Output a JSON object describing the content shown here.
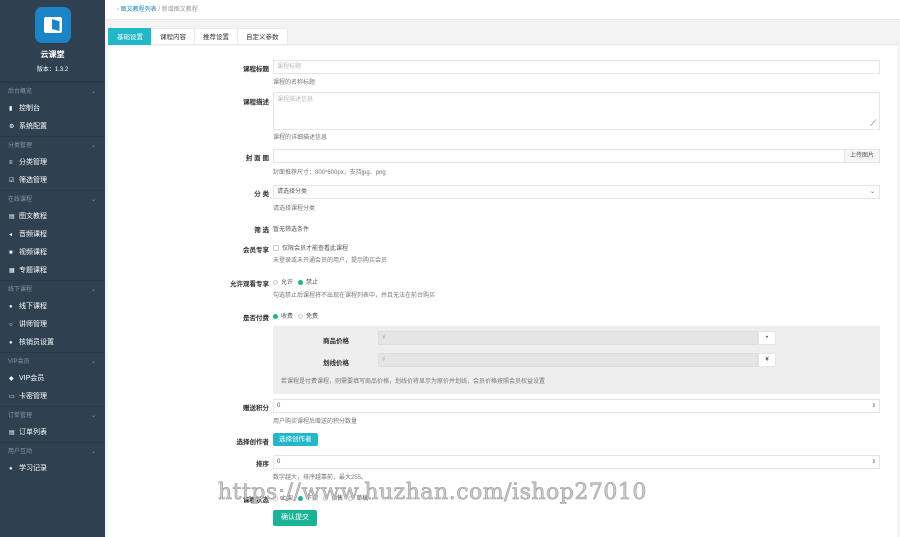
{
  "sidebar": {
    "brand_name": "云课堂",
    "version": "版本：1.3.2",
    "groups": [
      {
        "label": "后台概览",
        "items": [
          {
            "label": "控制台",
            "icon": "chart-icon"
          },
          {
            "label": "系统配置",
            "icon": "gear-icon"
          }
        ]
      },
      {
        "label": "分类管理",
        "items": [
          {
            "label": "分类管理",
            "icon": "list-icon"
          },
          {
            "label": "筛选管理",
            "icon": "check-icon"
          }
        ]
      },
      {
        "label": "在线课程",
        "items": [
          {
            "label": "图文教程",
            "icon": "doc-icon"
          },
          {
            "label": "音频课程",
            "icon": "audio-icon"
          },
          {
            "label": "视频课程",
            "icon": "video-icon"
          },
          {
            "label": "专题课程",
            "icon": "book-icon"
          }
        ]
      },
      {
        "label": "线下课程",
        "items": [
          {
            "label": "线下课程",
            "icon": "person-icon"
          },
          {
            "label": "讲师管理",
            "icon": "circle-icon"
          },
          {
            "label": "核销员设置",
            "icon": "person-add-icon"
          }
        ]
      },
      {
        "label": "VIP会员",
        "items": [
          {
            "label": "VIP会员",
            "icon": "diamond-icon"
          },
          {
            "label": "卡密管理",
            "icon": "card-icon"
          }
        ]
      },
      {
        "label": "订单管理",
        "items": [
          {
            "label": "订单列表",
            "icon": "orders-icon"
          }
        ]
      },
      {
        "label": "用户互动",
        "items": [
          {
            "label": "学习记录",
            "icon": "record-icon"
          }
        ]
      }
    ]
  },
  "breadcrumb": {
    "parent": "图文教程列表",
    "current": "新增图文教程"
  },
  "tabs": [
    "基础设置",
    "课程内容",
    "推荐设置",
    "自定义参数"
  ],
  "form": {
    "title": {
      "label": "课程标题",
      "placeholder": "课程标题",
      "help": "课程的名称标题"
    },
    "desc": {
      "label": "课程描述",
      "placeholder": "课程描述信息",
      "help": "课程的详细描述信息"
    },
    "cover": {
      "label": "封 面 图",
      "button": "上传图片",
      "help": "封面推荐尺寸：800*600px，支持jpg、png"
    },
    "category": {
      "label": "分 类",
      "value": "请选择分类",
      "help": "请选择课程分类"
    },
    "filter": {
      "label": "筛 选",
      "value": "暂无筛选条件"
    },
    "login": {
      "label": "会员专享",
      "option": "仅限会员才能查看此课程",
      "help": "未登录或未开通会员的用户，提示购买会员"
    },
    "allowed": {
      "label": "允许观看专享",
      "opt_yes": "允许",
      "opt_no": "禁止",
      "help": "勾选禁止后课程将不出现在课程列表中，并且无法在前台购买"
    },
    "pay": {
      "label": "是否付费",
      "opt_paid": "收费",
      "opt_free": "免费"
    },
    "price": {
      "label": "商品价格",
      "value": "¥",
      "marker": "•"
    },
    "sale_price": {
      "label": "划线价格",
      "value": "¥",
      "marker": "¥"
    },
    "price_help": "若课程是付费课程，则需要填写商品价格，划线价将显示为原价并划线，会员价格按照会员权益设置",
    "points": {
      "label": "赠送积分",
      "value": "0",
      "help": "用户购买课程后赠送的积分数量"
    },
    "author": {
      "label": "选择创作者",
      "button": "选择创作者"
    },
    "sort": {
      "label": "排序",
      "value": "0",
      "help": "数字越大，排序越靠前，最大255。"
    },
    "status": {
      "label": "课程状态",
      "opt_on": "上架",
      "opt_off": "下架",
      "opt_preview": "预售",
      "opt_draft": "草稿"
    },
    "submit": "确认提交"
  },
  "watermark": "https://www.huzhan.com/ishop27010"
}
